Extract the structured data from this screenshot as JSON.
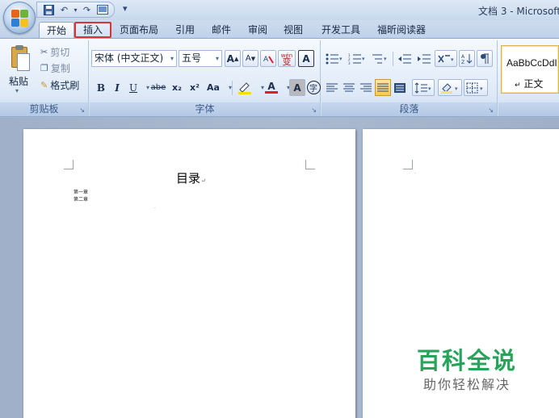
{
  "window": {
    "title": "文档 3 - Microsoft"
  },
  "quick_access": {
    "save": "save-icon",
    "undo": "undo-icon",
    "redo": "redo-icon",
    "print_preview": "print-preview-icon",
    "customize": "▾"
  },
  "tabs": [
    {
      "label": "开始",
      "state": "active"
    },
    {
      "label": "插入",
      "state": "highlighted"
    },
    {
      "label": "页面布局"
    },
    {
      "label": "引用"
    },
    {
      "label": "邮件"
    },
    {
      "label": "审阅"
    },
    {
      "label": "视图"
    },
    {
      "label": "开发工具"
    },
    {
      "label": "福昕阅读器"
    }
  ],
  "ribbon": {
    "clipboard": {
      "label": "剪贴板",
      "paste": "粘贴",
      "cut": "剪切",
      "copy": "复制",
      "format_painter": "格式刷"
    },
    "font": {
      "label": "字体",
      "font_name": "宋体 (中文正文)",
      "font_size": "五号",
      "grow": "A",
      "shrink": "A",
      "phonetic": "wén",
      "bold": "B",
      "italic": "I",
      "underline": "U",
      "strikethrough": "abe",
      "subscript": "x₂",
      "superscript": "x²",
      "change_case": "Aa",
      "font_color": "A",
      "char_shading": "A",
      "enclose": "字"
    },
    "paragraph": {
      "label": "段落"
    },
    "styles": {
      "sample": "AaBbCcDdI",
      "name": "正文"
    }
  },
  "document": {
    "page1": {
      "title": "目录",
      "toc": [
        "第一章",
        "第二章"
      ]
    }
  },
  "watermark": {
    "main": "百科全说",
    "sub": "助你轻松解决"
  },
  "colors": {
    "tab_highlight": "#d93434",
    "watermark_green": "#26a45a",
    "ribbon_bg": "#dfeaf7"
  }
}
